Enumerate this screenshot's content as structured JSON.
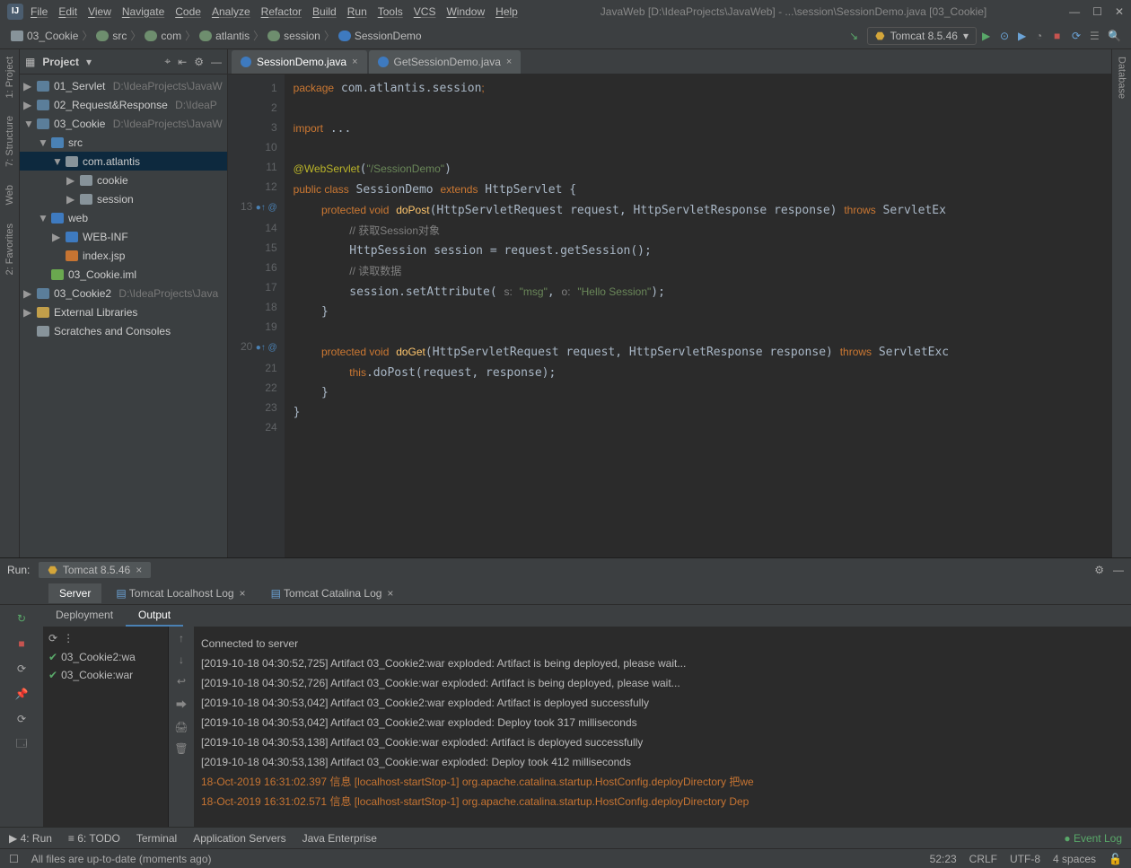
{
  "menu": [
    "File",
    "Edit",
    "View",
    "Navigate",
    "Code",
    "Analyze",
    "Refactor",
    "Build",
    "Run",
    "Tools",
    "VCS",
    "Window",
    "Help"
  ],
  "window_title": "JavaWeb [D:\\IdeaProjects\\JavaWeb] - ...\\session\\SessionDemo.java [03_Cookie]",
  "breadcrumb": [
    "03_Cookie",
    "src",
    "com",
    "atlantis",
    "session",
    "SessionDemo"
  ],
  "run_config": {
    "name": "Tomcat 8.5.46"
  },
  "project": {
    "title": "Project",
    "items": [
      {
        "indent": 0,
        "caret": "▶",
        "icon": "mod",
        "label": "01_Servlet",
        "path": "D:\\IdeaProjects\\JavaW"
      },
      {
        "indent": 0,
        "caret": "▶",
        "icon": "mod",
        "label": "02_Request&Response",
        "path": "D:\\IdeaP"
      },
      {
        "indent": 0,
        "caret": "▼",
        "icon": "mod",
        "label": "03_Cookie",
        "path": "D:\\IdeaProjects\\JavaW"
      },
      {
        "indent": 1,
        "caret": "▼",
        "icon": "src",
        "label": "src",
        "path": ""
      },
      {
        "indent": 2,
        "caret": "▼",
        "icon": "pkg",
        "label": "com.atlantis",
        "path": "",
        "selected": true
      },
      {
        "indent": 3,
        "caret": "▶",
        "icon": "pkg",
        "label": "cookie",
        "path": ""
      },
      {
        "indent": 3,
        "caret": "▶",
        "icon": "pkg",
        "label": "session",
        "path": ""
      },
      {
        "indent": 1,
        "caret": "▼",
        "icon": "web",
        "label": "web",
        "path": ""
      },
      {
        "indent": 2,
        "caret": "▶",
        "icon": "web",
        "label": "WEB-INF",
        "path": ""
      },
      {
        "indent": 2,
        "caret": "",
        "icon": "jsp",
        "label": "index.jsp",
        "path": ""
      },
      {
        "indent": 1,
        "caret": "",
        "icon": "iml",
        "label": "03_Cookie.iml",
        "path": ""
      },
      {
        "indent": 0,
        "caret": "▶",
        "icon": "mod",
        "label": "03_Cookie2",
        "path": "D:\\IdeaProjects\\Java"
      },
      {
        "indent": 0,
        "caret": "▶",
        "icon": "lib",
        "label": "External Libraries",
        "path": ""
      },
      {
        "indent": 0,
        "caret": "",
        "icon": "pkg",
        "label": "Scratches and Consoles",
        "path": ""
      }
    ]
  },
  "editor_tabs": [
    {
      "label": "SessionDemo.java",
      "active": true,
      "close": true
    },
    {
      "label": "GetSessionDemo.java",
      "active": false,
      "close": true
    }
  ],
  "code_lines": [
    1,
    2,
    3,
    10,
    11,
    12,
    13,
    14,
    15,
    16,
    17,
    18,
    19,
    20,
    21,
    22,
    23,
    24
  ],
  "code": {
    "l1": "package com.atlantis.session;",
    "l3": "import ...",
    "l11_ann": "@WebServlet",
    "l11_str": "\"/SessionDemo\"",
    "l12_kw1": "public class",
    "l12_cls": "SessionDemo",
    "l12_kw2": "extends",
    "l12_sup": "HttpServlet",
    "l13_kw1": "protected void",
    "l13_fn": "doPost",
    "l13_sig": "(HttpServletRequest request, HttpServletResponse response)",
    "l13_kw2": "throws",
    "l13_ex": "ServletEx",
    "l14_cmt": "// 获取Session对象",
    "l15": "HttpSession session = request.getSession();",
    "l16_cmt": "// 读取数据",
    "l17_a": "session.setAttribute(",
    "l17_p1": "s:",
    "l17_s1": "\"msg\"",
    "l17_p2": "o:",
    "l17_s2": "\"Hello Session\"",
    "l17_b": ");",
    "l20_kw1": "protected void",
    "l20_fn": "doGet",
    "l20_sig": "(HttpServletRequest request, HttpServletResponse response)",
    "l20_kw2": "throws",
    "l20_ex": "ServletExc",
    "l21_a": "this",
    "l21_b": ".doPost(request, response);"
  },
  "run": {
    "label": "Run:",
    "tab": "Tomcat 8.5.46",
    "tabs": [
      "Server",
      "Tomcat Localhost Log",
      "Tomcat Catalina Log"
    ],
    "subtabs": [
      "Deployment",
      "Output"
    ],
    "artifacts": [
      "03_Cookie2:wa",
      "03_Cookie:war"
    ],
    "output": [
      {
        "t": "Connected to server",
        "c": ""
      },
      {
        "t": "[2019-10-18 04:30:52,725] Artifact 03_Cookie2:war exploded: Artifact is being deployed, please wait...",
        "c": ""
      },
      {
        "t": "[2019-10-18 04:30:52,726] Artifact 03_Cookie:war exploded: Artifact is being deployed, please wait...",
        "c": ""
      },
      {
        "t": "[2019-10-18 04:30:53,042] Artifact 03_Cookie2:war exploded: Artifact is deployed successfully",
        "c": ""
      },
      {
        "t": "[2019-10-18 04:30:53,042] Artifact 03_Cookie2:war exploded: Deploy took 317 milliseconds",
        "c": ""
      },
      {
        "t": "[2019-10-18 04:30:53,138] Artifact 03_Cookie:war exploded: Artifact is deployed successfully",
        "c": ""
      },
      {
        "t": "[2019-10-18 04:30:53,138] Artifact 03_Cookie:war exploded: Deploy took 412 milliseconds",
        "c": ""
      },
      {
        "t": "18-Oct-2019 16:31:02.397 信息 [localhost-startStop-1] org.apache.catalina.startup.HostConfig.deployDirectory 把we",
        "c": "warn"
      },
      {
        "t": "18-Oct-2019 16:31:02.571 信息 [localhost-startStop-1] org.apache.catalina.startup.HostConfig.deployDirectory Dep",
        "c": "warn"
      }
    ]
  },
  "bottom_tools": [
    "▶ 4: Run",
    "≡ 6: TODO",
    "Terminal",
    "Application Servers",
    "Java Enterprise"
  ],
  "event_log": "Event Log",
  "status": {
    "msg": "All files are up-to-date (moments ago)",
    "pos": "52:23",
    "enc": "CRLF",
    "charset": "UTF-8",
    "indent": "4 spaces"
  },
  "left_gutter": [
    "1: Project",
    "7: Structure",
    "Web",
    "2: Favorites"
  ],
  "right_gutter": "Database"
}
